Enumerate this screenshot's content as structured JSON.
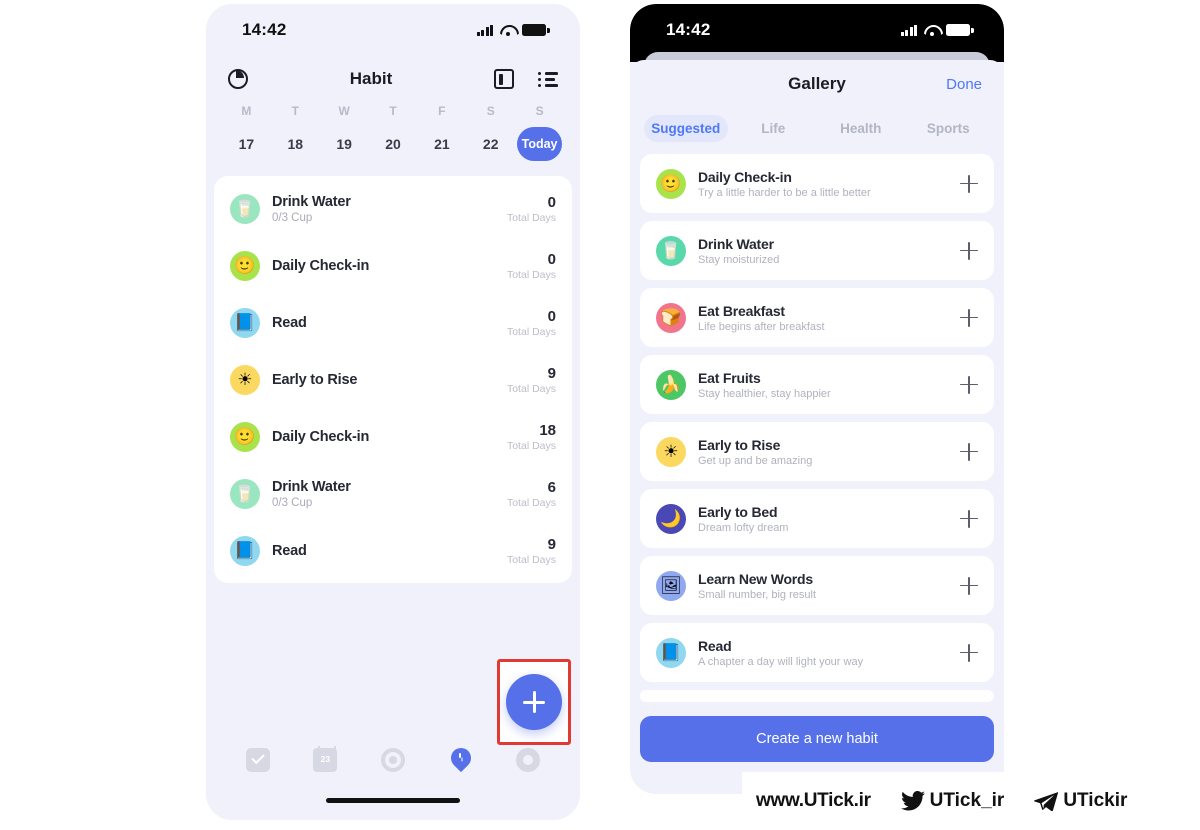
{
  "left_phone": {
    "status_bar": {
      "time": "14:42",
      "signal_icon": "signal-bars-icon",
      "wifi_icon": "wifi-icon",
      "battery_icon": "battery-icon"
    },
    "nav": {
      "stats_icon": "pie-chart-icon",
      "title": "Habit",
      "card_view_icon": "card-view-icon",
      "list_view_icon": "list-view-icon"
    },
    "week": {
      "day_labels": [
        "M",
        "T",
        "W",
        "T",
        "F",
        "S",
        "S"
      ],
      "dates": [
        "17",
        "18",
        "19",
        "20",
        "21",
        "22"
      ],
      "today_label": "Today"
    },
    "habits": [
      {
        "icon": "water-glass-icon",
        "emoji": "🥛",
        "bg": "#9ae6c0",
        "name": "Drink Water",
        "sub": "0/3 Cup",
        "count": "0",
        "unit": "Total Days"
      },
      {
        "icon": "smiley-icon",
        "emoji": "🙂",
        "bg": "#a9e34b",
        "name": "Daily Check-in",
        "sub": "",
        "count": "0",
        "unit": "Total Days"
      },
      {
        "icon": "book-icon",
        "emoji": "📘",
        "bg": "#8fd8ef",
        "name": "Read",
        "sub": "",
        "count": "0",
        "unit": "Total Days"
      },
      {
        "icon": "sun-icon",
        "emoji": "☀",
        "bg": "#fbd860",
        "name": "Early to Rise",
        "sub": "",
        "count": "9",
        "unit": "Total Days"
      },
      {
        "icon": "smiley-icon",
        "emoji": "🙂",
        "bg": "#a9e34b",
        "name": "Daily Check-in",
        "sub": "",
        "count": "18",
        "unit": "Total Days"
      },
      {
        "icon": "water-glass-icon",
        "emoji": "🥛",
        "bg": "#9ae6c0",
        "name": "Drink Water",
        "sub": "0/3 Cup",
        "count": "6",
        "unit": "Total Days"
      },
      {
        "icon": "book-icon",
        "emoji": "📘",
        "bg": "#8fd8ef",
        "name": "Read",
        "sub": "",
        "count": "9",
        "unit": "Total Days"
      }
    ],
    "fab": {
      "icon": "plus-icon",
      "highlight_color": "#e03b32",
      "color": "#5570e8"
    },
    "tabbar": [
      {
        "icon": "checkbox-tab-icon",
        "active": false
      },
      {
        "icon": "calendar-tab-icon",
        "active": false
      },
      {
        "icon": "target-tab-icon",
        "active": false
      },
      {
        "icon": "timer-pin-tab-icon",
        "active": true
      },
      {
        "icon": "settings-tab-icon",
        "active": false
      }
    ]
  },
  "right_phone": {
    "status_bar": {
      "time": "14:42",
      "signal_icon": "signal-bars-icon",
      "wifi_icon": "wifi-icon",
      "battery_icon": "battery-icon"
    },
    "sheet": {
      "title": "Gallery",
      "done_label": "Done",
      "tabs": [
        {
          "label": "Suggested",
          "active": true
        },
        {
          "label": "Life",
          "active": false
        },
        {
          "label": "Health",
          "active": false
        },
        {
          "label": "Sports",
          "active": false
        }
      ],
      "items": [
        {
          "icon": "smiley-icon",
          "emoji": "🙂",
          "bg": "#a9e34b",
          "name": "Daily Check-in",
          "sub": "Try a little harder to be a little better",
          "add_icon": "plus-icon"
        },
        {
          "icon": "water-glass-icon",
          "emoji": "🥛",
          "bg": "#59d9ab",
          "name": "Drink Water",
          "sub": "Stay moisturized",
          "add_icon": "plus-icon"
        },
        {
          "icon": "bread-icon",
          "emoji": "🍞",
          "bg": "#f2748c",
          "name": "Eat Breakfast",
          "sub": "Life begins after breakfast",
          "add_icon": "plus-icon"
        },
        {
          "icon": "banana-icon",
          "emoji": "🍌",
          "bg": "#4cc764",
          "name": "Eat Fruits",
          "sub": "Stay healthier, stay happier",
          "add_icon": "plus-icon"
        },
        {
          "icon": "sun-icon",
          "emoji": "☀",
          "bg": "#fbd860",
          "name": "Early to Rise",
          "sub": "Get up and be amazing",
          "add_icon": "plus-icon"
        },
        {
          "icon": "moon-zzz-icon",
          "emoji": "🌙",
          "bg": "#4a48b5",
          "name": "Early to Bed",
          "sub": "Dream lofty dream",
          "add_icon": "plus-icon"
        },
        {
          "icon": "flashcard-icon",
          "emoji": "🖼",
          "bg": "#8fa8f0",
          "name": "Learn New Words",
          "sub": "Small number, big result",
          "add_icon": "plus-icon"
        },
        {
          "icon": "book-icon",
          "emoji": "📘",
          "bg": "#8fd8ef",
          "name": "Read",
          "sub": "A chapter a day will light your way",
          "add_icon": "plus-icon"
        }
      ],
      "create_button": "Create a new habit"
    }
  },
  "watermark": {
    "website": "www.UTick.ir",
    "twitter_icon": "twitter-bird-icon",
    "twitter_handle": "UTick_ir",
    "telegram_icon": "telegram-plane-icon",
    "telegram_handle": "UTickir"
  }
}
